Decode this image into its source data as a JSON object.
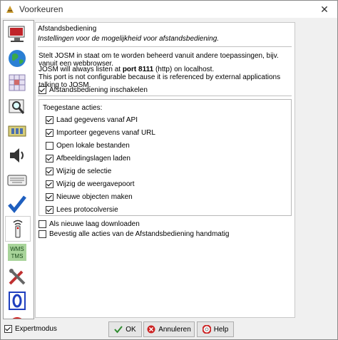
{
  "window": {
    "title": "Voorkeuren"
  },
  "sidebar": {
    "items": [
      {
        "icon": "display-icon"
      },
      {
        "icon": "globe-icon"
      },
      {
        "icon": "grid-icon"
      },
      {
        "icon": "magnifier-icon"
      },
      {
        "icon": "plugin-icon"
      },
      {
        "icon": "speaker-icon"
      },
      {
        "icon": "keyboard-icon"
      },
      {
        "icon": "checkmark-icon"
      },
      {
        "icon": "remote-control-icon"
      },
      {
        "icon": "wms-tms-icon",
        "label": "WMS TMS"
      },
      {
        "icon": "tools-icon"
      },
      {
        "icon": "validator-icon"
      },
      {
        "icon": "circle-arrow-icon"
      }
    ]
  },
  "panel": {
    "title": "Afstandsbediening",
    "subtitle": "Instellingen voor de mogelijkheid voor afstandsbediening.",
    "desc1": "Stelt JOSM in staat om te worden beheerd vanuit andere toepassingen, bijv. vanuit een webbrowser.",
    "desc2_prefix": "JOSM will always listen at ",
    "desc2_port": "port 8111",
    "desc2_suffix": " (http) on localhost.",
    "desc3": "This port is not configurable because it is referenced by external applications talking to JOSM.",
    "enable_label": "Afstandsbediening inschakelen",
    "enable_checked": true,
    "group_label": "Toegestane acties:",
    "actions": [
      {
        "label": "Laad gegevens vanaf API",
        "checked": true
      },
      {
        "label": "Importeer gegevens vanaf URL",
        "checked": true
      },
      {
        "label": "Open lokale bestanden",
        "checked": false
      },
      {
        "label": "Afbeeldingslagen laden",
        "checked": true
      },
      {
        "label": "Wijzig de selectie",
        "checked": true
      },
      {
        "label": "Wijzig de weergavepoort",
        "checked": true
      },
      {
        "label": "Nieuwe objecten maken",
        "checked": true
      },
      {
        "label": "Lees protocolversie",
        "checked": true
      }
    ],
    "extra": [
      {
        "label": "Als nieuwe laag downloaden",
        "checked": false
      },
      {
        "label": "Bevestig alle acties van de Afstandsbediening handmatig",
        "checked": false
      }
    ]
  },
  "footer": {
    "expert_label": "Expertmodus",
    "expert_checked": true,
    "ok_label": "OK",
    "cancel_label": "Annuleren",
    "help_label": "Help"
  },
  "colors": {
    "accent": "#1f5fbf",
    "ok_green": "#2e8b2e",
    "cancel_red": "#cc2222"
  }
}
